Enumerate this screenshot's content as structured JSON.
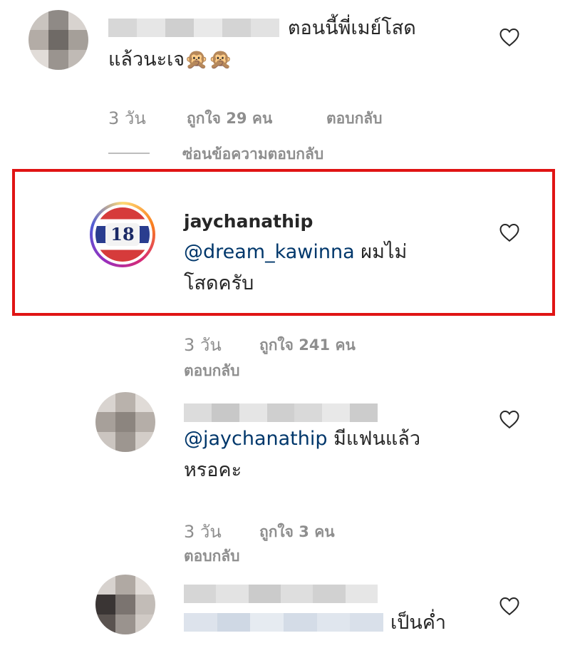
{
  "comments": [
    {
      "text_line1": "ตอนนี้พี่เมย์โสด",
      "text_line2": "แล้วนะเจ",
      "emoji": "🙊🙊",
      "time": "3 วัน",
      "likes": "ถูกใจ 29 คน",
      "reply": "ตอบกลับ",
      "hide_replies": "ซ่อนข้อความตอบกลับ"
    },
    {
      "username": "jaychanathip",
      "mention": "@dream_kawinna",
      "text_line1": "ผมไม่",
      "text_line2": "โสดครับ",
      "time": "3 วัน",
      "likes": "ถูกใจ 241 คน",
      "reply": "ตอบกลับ",
      "avatar_text": "18"
    },
    {
      "mention": "@jaychanathip",
      "text_line1": "มีแฟนแล้ว",
      "text_line2": "หรอคะ",
      "time": "3 วัน",
      "likes": "ถูกใจ 3 คน",
      "reply": "ตอบกลับ"
    },
    {
      "text_line2": "เป็นค่ำ"
    }
  ],
  "colors": {
    "highlight": "#e01414",
    "mention": "#00376b",
    "meta": "#8e8e8e"
  },
  "icons": [
    "heart-icon"
  ]
}
